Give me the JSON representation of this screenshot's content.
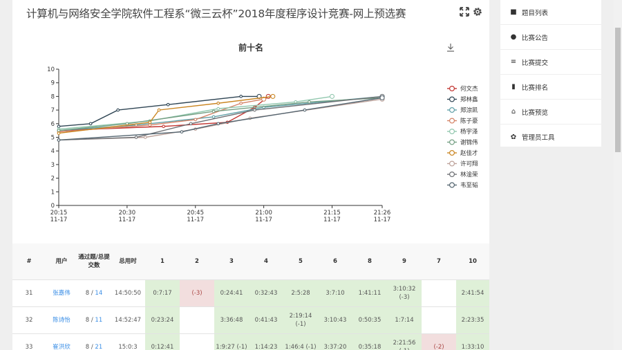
{
  "page": {
    "title": "计算机与网络安全学院软件工程系“微三云杯”2018年度程序设计竞赛-网上预选赛",
    "fullscreen_icon": "expand-icon",
    "settings_icon": "gear-icon"
  },
  "sidebar": {
    "items": [
      {
        "label": "题目列表",
        "icon": "book-icon"
      },
      {
        "label": "比赛公告",
        "icon": "chat-icon"
      },
      {
        "label": "比赛提交",
        "icon": "list-icon"
      },
      {
        "label": "比赛排名",
        "icon": "bar-chart-icon"
      },
      {
        "label": "比赛预览",
        "icon": "home-icon"
      },
      {
        "label": "管理员工具",
        "icon": "paw-icon"
      }
    ]
  },
  "chart_data": {
    "type": "line",
    "title": "前十名",
    "ylim": [
      0,
      10
    ],
    "yticks": [
      "0",
      "1",
      "2",
      "3",
      "4",
      "5",
      "6",
      "7",
      "8",
      "9",
      "10"
    ],
    "xticks": [
      {
        "time": "20:15",
        "date": "11-17"
      },
      {
        "time": "20:30",
        "date": "11-17"
      },
      {
        "time": "20:45",
        "date": "11-17"
      },
      {
        "time": "21:00",
        "date": "11-17"
      },
      {
        "time": "21:15",
        "date": "11-17"
      },
      {
        "time": "21:26",
        "date": "11-17"
      }
    ],
    "xlim": [
      "20:15",
      "21:26"
    ],
    "legend_position": "right",
    "download_icon": "download-icon",
    "series": [
      {
        "name": "何文杰",
        "color": "#c23531",
        "points": [
          [
            "20:15",
            5.5
          ],
          [
            "20:38",
            5.8
          ],
          [
            "20:52",
            6.1
          ],
          [
            "20:58",
            7.2
          ],
          [
            "21:01",
            8.0
          ]
        ]
      },
      {
        "name": "郑林鑫",
        "color": "#2f4554",
        "points": [
          [
            "20:15",
            5.8
          ],
          [
            "20:22",
            6.0
          ],
          [
            "20:28",
            7.0
          ],
          [
            "20:39",
            7.4
          ],
          [
            "20:55",
            8.0
          ],
          [
            "20:59",
            8.0
          ]
        ]
      },
      {
        "name": "郑淙凯",
        "color": "#61a0a8",
        "points": [
          [
            "20:15",
            5.5
          ],
          [
            "20:32",
            5.9
          ],
          [
            "20:49",
            6.5
          ],
          [
            "21:00",
            7.2
          ],
          [
            "21:26",
            8.0
          ]
        ]
      },
      {
        "name": "陈子豪",
        "color": "#d48265",
        "points": [
          [
            "20:15",
            5.4
          ],
          [
            "20:35",
            5.9
          ],
          [
            "20:45",
            6.3
          ],
          [
            "20:55",
            7.5
          ],
          [
            "21:00",
            7.8
          ]
        ]
      },
      {
        "name": "杨宇泽",
        "color": "#91c7ae",
        "points": [
          [
            "20:15",
            5.6
          ],
          [
            "20:35",
            6.2
          ],
          [
            "20:50",
            7.1
          ],
          [
            "21:07",
            7.6
          ],
          [
            "21:15",
            8.0
          ]
        ]
      },
      {
        "name": "谢锦伟",
        "color": "#749f83",
        "points": [
          [
            "20:15",
            5.5
          ],
          [
            "20:30",
            6.0
          ],
          [
            "20:49",
            6.9
          ],
          [
            "21:10",
            7.6
          ],
          [
            "21:26",
            7.9
          ]
        ]
      },
      {
        "name": "赵佳才",
        "color": "#ca8622",
        "points": [
          [
            "20:15",
            5.3
          ],
          [
            "20:35",
            6.1
          ],
          [
            "20:37",
            7.0
          ],
          [
            "20:50",
            7.5
          ],
          [
            "21:02",
            8.0
          ]
        ]
      },
      {
        "name": "许可翔",
        "color": "#bda29a",
        "points": [
          [
            "20:15",
            4.8
          ],
          [
            "20:34",
            5.0
          ],
          [
            "20:45",
            5.6
          ],
          [
            "20:57",
            6.4
          ],
          [
            "21:26",
            7.8
          ]
        ]
      },
      {
        "name": "林淦荣",
        "color": "#6e7074",
        "points": [
          [
            "20:15",
            4.8
          ],
          [
            "20:32",
            5.0
          ],
          [
            "20:44",
            6.0
          ],
          [
            "20:58",
            7.0
          ],
          [
            "21:26",
            8.0
          ]
        ]
      },
      {
        "name": "韦至韬",
        "color": "#546570",
        "points": [
          [
            "20:15",
            4.8
          ],
          [
            "20:42",
            5.4
          ],
          [
            "20:50",
            6.0
          ],
          [
            "21:09",
            7.0
          ],
          [
            "21:26",
            7.9
          ]
        ]
      }
    ]
  },
  "table": {
    "headers": [
      "#",
      "用户",
      "通过题/总提交数",
      "总用时",
      "1",
      "2",
      "3",
      "4",
      "5",
      "6",
      "8",
      "9",
      "7",
      "10"
    ],
    "rows": [
      {
        "rank": "31",
        "user": "张嘉伟",
        "solved": "8 / 14",
        "time": "14:50:50",
        "cells": [
          {
            "text": "0:7:17",
            "status": "ac"
          },
          {
            "text": "(-3)",
            "status": "wa"
          },
          {
            "text": "0:24:41",
            "status": "ac"
          },
          {
            "text": "0:32:43",
            "status": "ac"
          },
          {
            "text": "2:5:28",
            "status": "ac"
          },
          {
            "text": "3:7:10",
            "status": "ac"
          },
          {
            "text": "1:41:11",
            "status": "ac"
          },
          {
            "text": "3:10:32 (-3)",
            "status": "ac"
          },
          {
            "text": "",
            "status": ""
          },
          {
            "text": "2:41:54",
            "status": "ac"
          }
        ]
      },
      {
        "rank": "32",
        "user": "陈诗怡",
        "solved": "8 / 11",
        "time": "14:52:47",
        "cells": [
          {
            "text": "0:23:24",
            "status": "ac"
          },
          {
            "text": "",
            "status": ""
          },
          {
            "text": "3:36:48",
            "status": "ac"
          },
          {
            "text": "0:41:43",
            "status": "ac"
          },
          {
            "text": "2:19:14 (-1)",
            "status": "ac"
          },
          {
            "text": "3:10:43",
            "status": "ac"
          },
          {
            "text": "0:50:35",
            "status": "ac"
          },
          {
            "text": "1:7:14",
            "status": "ac"
          },
          {
            "text": "",
            "status": ""
          },
          {
            "text": "2:23:35",
            "status": "ac"
          }
        ]
      },
      {
        "rank": "33",
        "user": "崔洪欣",
        "solved": "8 / 21",
        "time": "15:0:3",
        "cells": [
          {
            "text": "0:12:41",
            "status": "ac"
          },
          {
            "text": "",
            "status": ""
          },
          {
            "text": "1:9:27 (-1)",
            "status": "ac"
          },
          {
            "text": "1:14:23",
            "status": "ac"
          },
          {
            "text": "1:46:4 (-1)",
            "status": "ac"
          },
          {
            "text": "3:37:20",
            "status": "ac"
          },
          {
            "text": "0:35:18",
            "status": "ac"
          },
          {
            "text": "2:21:56 (-1)",
            "status": "ac"
          },
          {
            "text": "(-2)",
            "status": "wa"
          },
          {
            "text": "1:33:10",
            "status": "ac"
          }
        ]
      }
    ]
  }
}
